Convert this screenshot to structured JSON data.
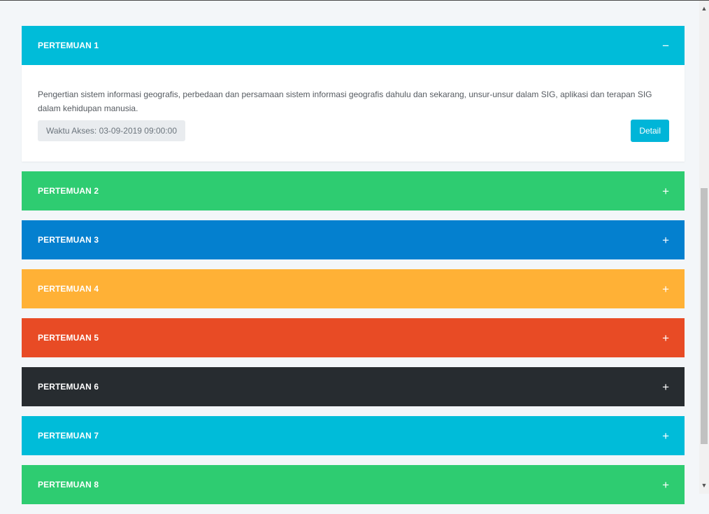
{
  "panels": [
    {
      "title": "PERTEMUAN 1",
      "toggle": "−",
      "color": "#00bcd9",
      "expanded": true,
      "description": "Pengertian sistem informasi geografis, perbedaan dan persamaan sistem informasi geografis dahulu dan sekarang, unsur-unsur dalam SIG, aplikasi dan terapan SIG dalam kehidupan manusia.",
      "access_time": "Waktu Akses: 03-09-2019 09:00:00",
      "detail_label": "Detail"
    },
    {
      "title": "PERTEMUAN 2",
      "toggle": "+",
      "color": "#2ecc71"
    },
    {
      "title": "PERTEMUAN 3",
      "toggle": "+",
      "color": "#0480cf"
    },
    {
      "title": "PERTEMUAN 4",
      "toggle": "+",
      "color": "#ffb136"
    },
    {
      "title": "PERTEMUAN 5",
      "toggle": "+",
      "color": "#e84b25"
    },
    {
      "title": "PERTEMUAN 6",
      "toggle": "+",
      "color": "#272c30"
    },
    {
      "title": "PERTEMUAN 7",
      "toggle": "+",
      "color": "#00bcd9"
    },
    {
      "title": "PERTEMUAN 8",
      "toggle": "+",
      "color": "#2ecc71"
    }
  ],
  "scrollbar": {
    "up_icon": "▲",
    "down_icon": "▼"
  }
}
